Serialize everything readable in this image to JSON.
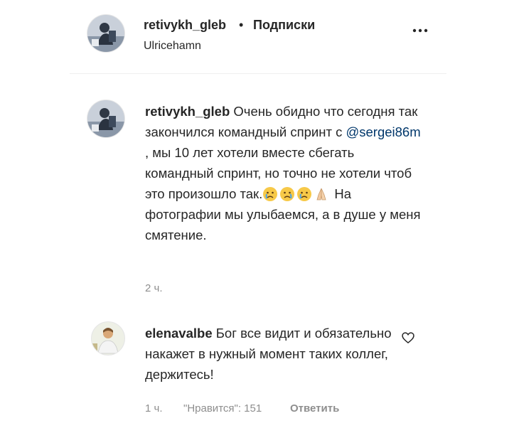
{
  "header": {
    "username": "retivykh_gleb",
    "separator": "•",
    "follow_label": "Подписки",
    "location": "Ulricehamn",
    "more_icon": "more-horizontal-icon"
  },
  "comments": [
    {
      "username": "retivykh_gleb",
      "text_before_mention": "Очень обидно что сегодня так закончился командный спринт с ",
      "mention": "@sergei86m",
      "text_after_mention": " , мы 10 лет хотели вместе сбегать командный спринт, но точно не хотели чтоб это произошло так.",
      "emojis": [
        "crying-face-emoji",
        "crying-face-emoji",
        "crying-face-emoji",
        "folded-hands-emoji"
      ],
      "text_after_emojis": " На фотографии мы улыбаемся, а в душе у меня смятение.",
      "time": "2 ч."
    },
    {
      "username": "elenavalbe",
      "text": " Бог все видит и обязательно накажет в нужный момент таких коллег, держитесь!",
      "time": "1 ч.",
      "likes": "\"Нравится\": 151",
      "reply_label": "Ответить",
      "like_icon": "heart-outline-icon"
    }
  ],
  "colors": {
    "text": "#262626",
    "secondary": "#8e8e8e",
    "mention": "#00376b",
    "divider": "#efefef"
  }
}
